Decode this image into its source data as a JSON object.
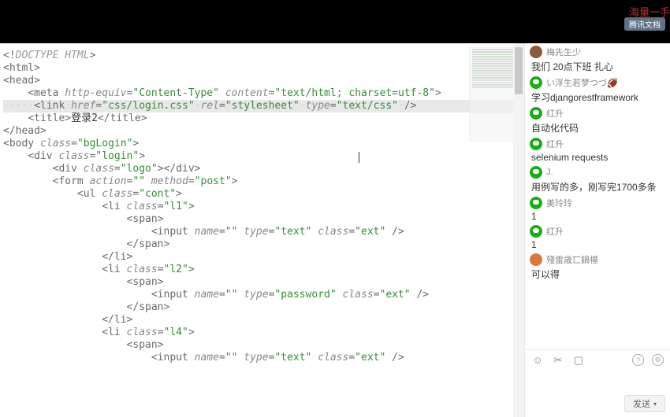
{
  "topbar": {
    "watermark": "海量一手"
  },
  "code": {
    "doctype": "DOCTYPE HTML",
    "html": "html",
    "head": "head",
    "meta_attr1": "http-equiv",
    "meta_val1": "Content-Type",
    "meta_attr2": "content",
    "meta_val2": "text/html; charset=utf-8",
    "link_href": "css/login.css",
    "link_rel": "stylesheet",
    "link_type": "text/css",
    "title_tag": "title",
    "title_text": "登录2",
    "head_close": "head",
    "body_tag": "body",
    "body_class": "bgLogin",
    "div_login": "login",
    "div_logo": "logo",
    "form_method": "post",
    "ul_class": "cont",
    "li1": "l1",
    "li2": "l2",
    "li4": "l4",
    "span": "span",
    "input": "input",
    "type_text": "text",
    "type_password": "password",
    "class_ext": "ext",
    "div": "div",
    "form": "form",
    "ul": "ul",
    "li": "li",
    "link": "link",
    "meta": "meta",
    "name_attr": "name",
    "class_attr": "class",
    "action_attr": "action",
    "method_attr": "method",
    "href_attr": "href",
    "rel_attr": "rel",
    "type_attr": "type"
  },
  "chat": {
    "badge": "腾讯文档",
    "items": [
      {
        "avatar": "br",
        "name": "梅先生少",
        "msg": "我们 20点下班 扎心"
      },
      {
        "avatar": "wx",
        "name": "い浮生若梦つづ🏈",
        "msg": "学习djangorestframework"
      },
      {
        "avatar": "wx",
        "name": "红升",
        "msg": "自动化代码"
      },
      {
        "avatar": "wx",
        "name": "红升",
        "msg": "selenium  requests"
      },
      {
        "avatar": "wx",
        "name": "J.",
        "msg": "用例写的多，刚写完1700多条"
      },
      {
        "avatar": "wx",
        "name": "美玲玲",
        "msg": "1"
      },
      {
        "avatar": "wx",
        "name": "红升",
        "msg": "1"
      },
      {
        "avatar": "or",
        "name": "殘雷歳匸鍋樭",
        "msg": "可以得"
      }
    ],
    "send": "发送"
  }
}
